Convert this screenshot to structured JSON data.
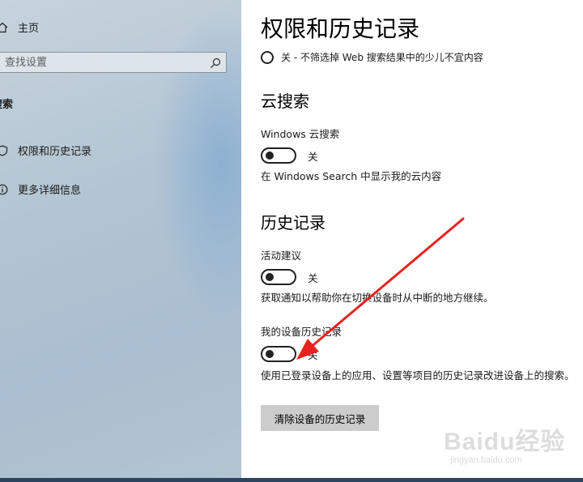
{
  "sidebar": {
    "home_label": "主页",
    "search": {
      "placeholder": "查找设置"
    },
    "section_label": "搜索",
    "items": [
      {
        "label": "权限和历史记录",
        "icon": "shield-icon"
      },
      {
        "label": "更多详细信息",
        "icon": "info-icon"
      }
    ]
  },
  "main": {
    "title": "权限和历史记录",
    "safe_search_option": "关 - 不筛选掉 Web 搜索结果中的少儿不宜内容",
    "cloud_search": {
      "heading": "云搜索",
      "windows_cloud_label": "Windows 云搜索",
      "toggle_state": "关",
      "toggle_on": false,
      "description": "在 Windows Search 中显示我的云内容"
    },
    "history": {
      "heading": "历史记录",
      "activity_label": "活动建议",
      "activity_state": "关",
      "activity_on": false,
      "activity_description": "获取通知以帮助你在切换设备时从中断的地方继续。",
      "device_history_label": "我的设备历史记录",
      "device_history_state": "关",
      "device_history_on": false,
      "device_history_description": "使用已登录设备上的应用、设置等项目的历史记录改进设备上的搜索。",
      "clear_button": "清除设备的历史记录"
    }
  },
  "watermark": {
    "main": "Baidu经验",
    "sub": "jingyan.baidu.com"
  },
  "colors": {
    "annotation_arrow": "#e8231f",
    "sidebar_tint": "#b3c5d3",
    "button_bg": "#cccccc"
  }
}
